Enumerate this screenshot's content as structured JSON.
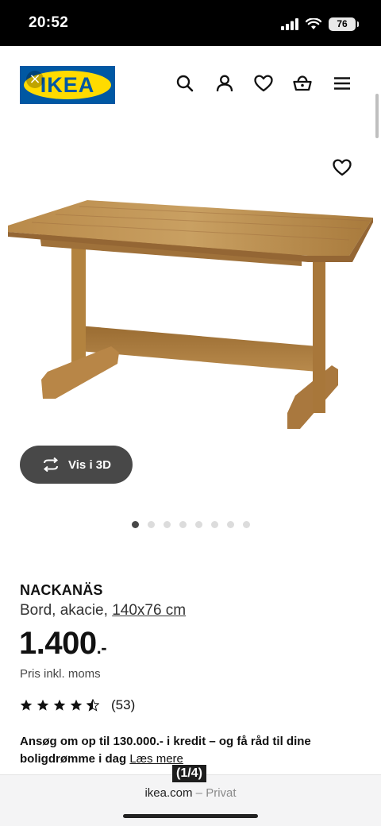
{
  "status_bar": {
    "time": "20:52",
    "battery": "76"
  },
  "header": {
    "logo_text": "IKEA",
    "icons": [
      "search-icon",
      "user-icon",
      "heart-icon",
      "basket-icon",
      "menu-icon"
    ]
  },
  "gallery": {
    "view_3d_label": "Vis i 3D",
    "dot_count": 8,
    "active_dot": 0
  },
  "product": {
    "name": "NACKANÄS",
    "description": "Bord, akacie,",
    "size": "140x76 cm",
    "price": "1.400",
    "price_suffix": ".-",
    "price_note": "Pris inkl. moms",
    "rating_value": 4.5,
    "rating_count": "(53)",
    "credit_text": "Ansøg om op til 130.000.- i kredit – og få råd til dine boligdrømme i dag",
    "credit_link": "Læs mere"
  },
  "browser": {
    "domain": "ikea.com",
    "separator": " – ",
    "mode": "Privat",
    "counter": "(1/4)"
  },
  "colors": {
    "ikea_blue": "#0058a3",
    "ikea_yellow": "#ffdb00",
    "button_dark": "#484848"
  }
}
